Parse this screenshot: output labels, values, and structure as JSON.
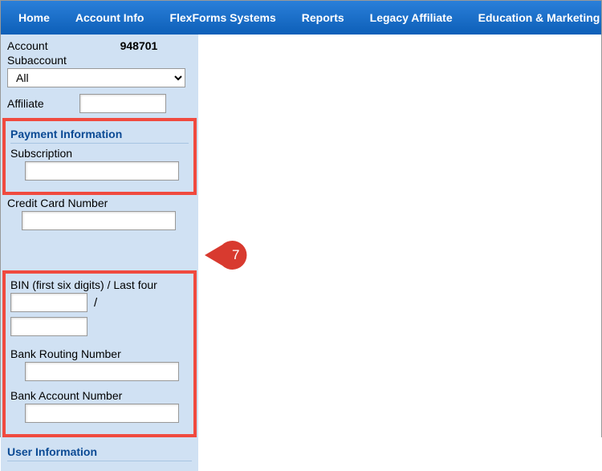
{
  "nav": {
    "items": [
      "Home",
      "Account Info",
      "FlexForms Systems",
      "Reports",
      "Legacy Affiliate",
      "Education & Marketing"
    ]
  },
  "sidebar": {
    "account_label": "Account",
    "account_value": "948701",
    "subaccount_label": "Subaccount",
    "subaccount_value": "All",
    "affiliate_label": "Affiliate",
    "affiliate_value": "",
    "payment_section": {
      "header": "Payment Information",
      "subscription_label": "Subscription",
      "subscription_value": "",
      "cc_label": "Credit Card Number",
      "cc_value": "",
      "bin_label": "BIN (first six digits) / Last four",
      "bin_value": "",
      "last4_value": "",
      "routing_label": "Bank Routing Number",
      "routing_value": "",
      "bank_account_label": "Bank Account Number",
      "bank_account_value": ""
    },
    "user_section": {
      "header": "User Information"
    }
  },
  "callout": {
    "number": "7"
  },
  "misc": {
    "slash": "/"
  }
}
